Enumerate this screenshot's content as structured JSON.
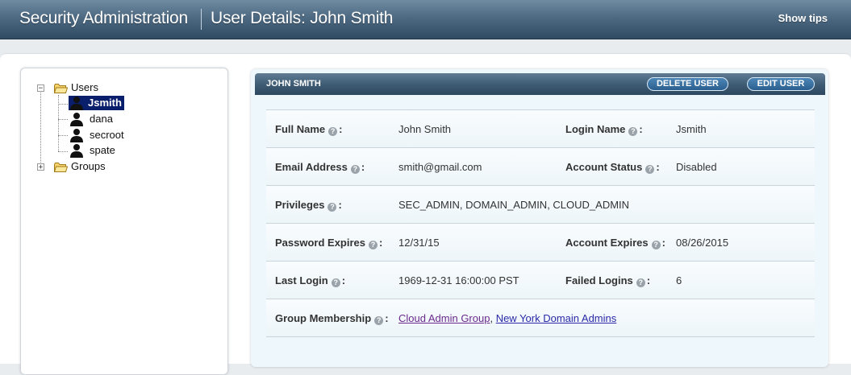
{
  "header": {
    "app_title": "Security Administration",
    "page_title": "User Details: John Smith",
    "show_tips": "Show tips"
  },
  "tree": {
    "users_label": "Users",
    "groups_label": "Groups",
    "users": [
      {
        "label": "Jsmith",
        "selected": true
      },
      {
        "label": "dana"
      },
      {
        "label": "secroot"
      },
      {
        "label": "spate"
      }
    ],
    "expander_users": "−",
    "expander_groups": "+"
  },
  "details": {
    "name_header": "JOHN SMITH",
    "delete_button": "DELETE USER",
    "edit_button": "EDIT USER",
    "help_glyph": "?",
    "fields": {
      "full_name_label": "Full Name",
      "full_name": "John Smith",
      "login_name_label": "Login Name",
      "login_name": "Jsmith",
      "email_label": "Email Address",
      "email": "smith@gmail.com",
      "account_status_label": "Account Status",
      "account_status": "Disabled",
      "privileges_label": "Privileges",
      "privileges": "SEC_ADMIN, DOMAIN_ADMIN, CLOUD_ADMIN",
      "password_expires_label": "Password Expires",
      "password_expires": "12/31/15",
      "account_expires_label": "Account Expires",
      "account_expires": "08/26/2015",
      "last_login_label": "Last Login",
      "last_login": "1969-12-31 16:00:00 PST",
      "failed_logins_label": "Failed Logins",
      "failed_logins": "6",
      "group_membership_label": "Group Membership",
      "groups": [
        "Cloud Admin Group",
        "New York Domain Admins"
      ],
      "group_separator": ", "
    }
  },
  "colors": {
    "header_dark": "#2f4b63",
    "selection": "#0a1f6b",
    "link": "#2a2aa8",
    "visited_link": "#6a2a8c"
  },
  "icons": [
    "folder-icon",
    "user-icon",
    "help-icon",
    "expand-icon",
    "collapse-icon"
  ]
}
